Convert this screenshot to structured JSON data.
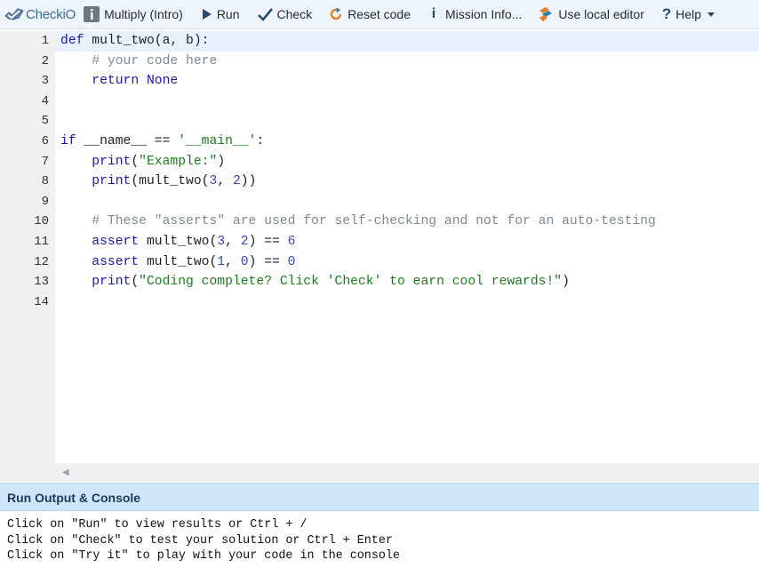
{
  "toolbar": {
    "brand": "CheckiO",
    "mission": "Multiply (Intro)",
    "run": "Run",
    "check": "Check",
    "reset": "Reset code",
    "mission_info": "Mission Info...",
    "local_editor": "Use local editor",
    "help": "Help",
    "icons": [
      "checkio-logo-icon",
      "mission-info-square-icon",
      "play-icon",
      "checkmark-icon",
      "reset-refresh-icon",
      "info-i-icon",
      "local-editor-icon",
      "question-icon",
      "chevron-down-icon"
    ]
  },
  "editor": {
    "line_numbers": [
      "1",
      "2",
      "3",
      "4",
      "5",
      "6",
      "7",
      "8",
      "9",
      "10",
      "11",
      "12",
      "13",
      "14"
    ],
    "active_line": 1,
    "lines": [
      "def mult_two(a, b):",
      "    # your code here",
      "    return None",
      "",
      "",
      "if __name__ == '__main__':",
      "    print(\"Example:\")",
      "    print(mult_two(3, 2))",
      "",
      "    # These \"asserts\" are used for self-checking and not for an auto-testing",
      "    assert mult_two(3, 2) == 6",
      "    assert mult_two(1, 0) == 0",
      "    print(\"Coding complete? Click 'Check' to earn cool rewards!\")",
      ""
    ]
  },
  "console": {
    "title": "Run Output & Console",
    "lines": [
      "Click on \"Run\" to view results or Ctrl + /",
      "Click on \"Check\" to test your solution or Ctrl + Enter",
      "Click on \"Try it\" to play with your code in the console"
    ]
  },
  "colors": {
    "toolbar_bg": "#eef4fb",
    "gutter_bg": "#f0f0f0",
    "active_line_bg": "#e8f2ff",
    "keyword": "#1a1aa6",
    "string": "#1f7a1f",
    "comment": "#7f8a93",
    "console_header_bg": "#cfe6f8"
  }
}
